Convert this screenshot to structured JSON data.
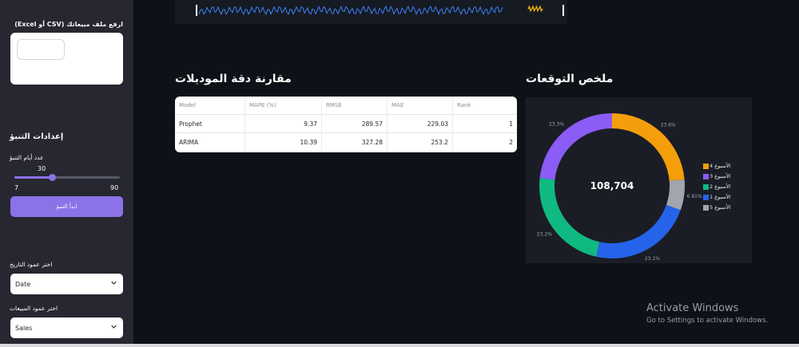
{
  "sidebar": {
    "upload_label": "ارفع ملف مبيعاتك (CSV أو Excel)",
    "settings_title": "إعدادات التنبؤ",
    "slider_label": "عدد أيام التنبؤ",
    "slider": {
      "value": "30",
      "min": "7",
      "max": "90",
      "fraction": 0.361
    },
    "run_button": "ابدأ التنبؤ",
    "date_column_label": "اختر عمود التاريخ",
    "date_column_value": "Date",
    "sales_column_label": "اختر عمود المبيعات",
    "sales_column_value": "Sales"
  },
  "main": {
    "comparison_title": "مقارنة دقة الموديلات",
    "summary_title": "ملخص التوقعات",
    "table": {
      "headers": [
        "Model",
        "MAPE (%)",
        "RMSE",
        "MAE",
        "Rank"
      ],
      "rows": [
        [
          "Prophet",
          "9.37",
          "289.57",
          "229.03",
          "1"
        ],
        [
          "ARIMA",
          "10.39",
          "327.28",
          "253.2",
          "2"
        ]
      ]
    }
  },
  "chart_data": {
    "type": "pie",
    "center_label": "108,704",
    "slices": [
      {
        "name": "الأسبوع 4",
        "value": 23.6,
        "label": "23.6%",
        "color": "#f59e0b"
      },
      {
        "name": "الأسبوع 5",
        "value": 6.81,
        "label": "6.81%",
        "color": "#a1a5ad"
      },
      {
        "name": "الأسبوع 1",
        "value": 23.1,
        "label": "23.1%",
        "color": "#2563eb"
      },
      {
        "name": "الأسبوع 2",
        "value": 23.2,
        "label": "23.2%",
        "color": "#10b981"
      },
      {
        "name": "الأسبوع 3",
        "value": 23.3,
        "label": "23.3%",
        "color": "#8b5cf6"
      }
    ],
    "legend": [
      "الأسبوع 4",
      "الأسبوع 3",
      "الأسبوع 2",
      "الأسبوع 1",
      "الأسبوع 5"
    ],
    "legend_placement": "right"
  },
  "watermark": {
    "title": "Activate Windows",
    "subtitle": "Go to Settings to activate Windows."
  },
  "colors": {
    "accent": "#8b72e8",
    "background": "#0e1117",
    "sidebar": "#262730"
  }
}
